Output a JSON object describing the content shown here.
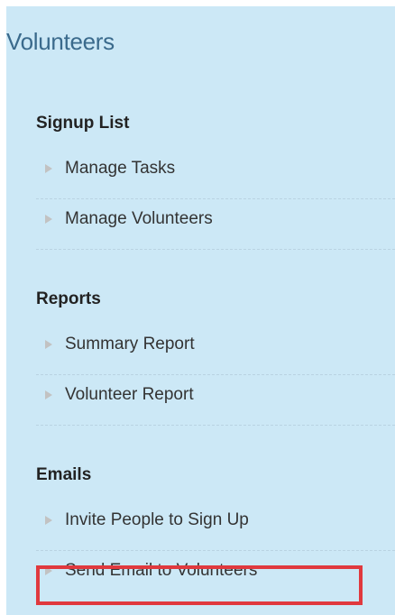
{
  "panel": {
    "title": "Volunteers"
  },
  "sections": [
    {
      "title": "Signup List",
      "items": [
        {
          "label": "Manage Tasks",
          "icon": "triangle-right-icon"
        },
        {
          "label": "Manage Volunteers",
          "icon": "triangle-right-icon"
        }
      ]
    },
    {
      "title": "Reports",
      "items": [
        {
          "label": "Summary Report",
          "icon": "triangle-right-icon"
        },
        {
          "label": "Volunteer Report",
          "icon": "triangle-right-icon"
        }
      ]
    },
    {
      "title": "Emails",
      "items": [
        {
          "label": "Invite People to Sign Up",
          "icon": "triangle-right-icon"
        },
        {
          "label": "Send Email to Volunteers",
          "icon": "triangle-right-icon",
          "highlighted": true
        }
      ]
    }
  ],
  "colors": {
    "panel_background": "#cce8f6",
    "title": "#3a6a8c",
    "highlight": "#e0393e",
    "arrow": "#c2c2c2"
  }
}
